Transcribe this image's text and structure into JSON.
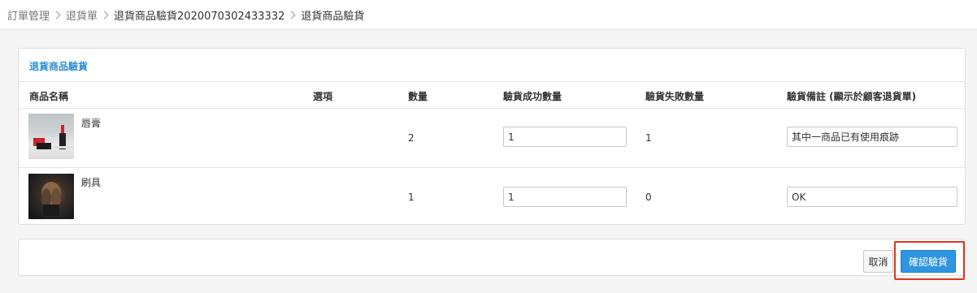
{
  "breadcrumb": {
    "items": [
      "訂單管理",
      "退貨單",
      "退貨商品驗貨2020070302433332",
      "退貨商品驗貨"
    ]
  },
  "card": {
    "title": "退貨商品驗貨",
    "headers": {
      "name": "商品名稱",
      "option": "選項",
      "qty": "數量",
      "ok_qty": "驗貨成功數量",
      "fail_qty": "驗貨失敗數量",
      "note": "驗貨備註 (顯示於顧客退貨單)"
    },
    "rows": [
      {
        "name": "唇膏",
        "option": "",
        "qty": "2",
        "ok_qty": "1",
        "fail_qty": "1",
        "note": "其中一商品已有使用痕跡"
      },
      {
        "name": "刷具",
        "option": "",
        "qty": "1",
        "ok_qty": "1",
        "fail_qty": "0",
        "note": "OK"
      }
    ]
  },
  "footer": {
    "cancel_label": "取消",
    "confirm_label": "確認驗貨"
  },
  "colors": {
    "accent": "#2f95e0",
    "title": "#2d8fd8",
    "highlight": "#e0341d"
  }
}
